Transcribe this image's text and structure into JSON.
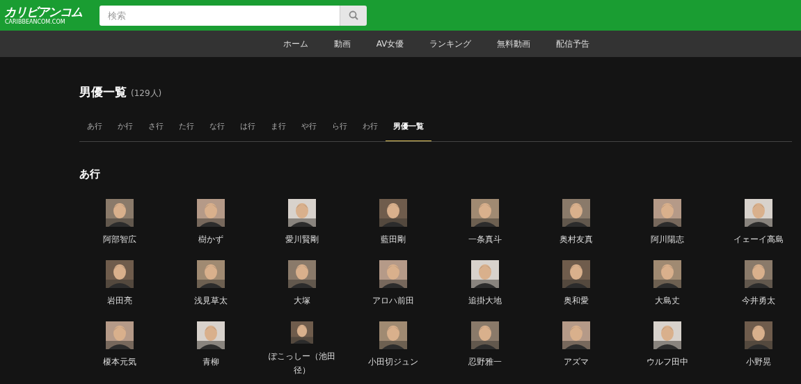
{
  "logo": {
    "title": "カリビアンコム",
    "subtitle": "CARIBBEANCOM.COM"
  },
  "search": {
    "placeholder": "検索"
  },
  "nav": [
    "ホーム",
    "動画",
    "AV女優",
    "ランキング",
    "無料動画",
    "配信予告"
  ],
  "page": {
    "title": "男優一覧",
    "count": "(129人)"
  },
  "tabs": [
    {
      "label": "あ行",
      "selected": false
    },
    {
      "label": "か行",
      "selected": false
    },
    {
      "label": "さ行",
      "selected": false
    },
    {
      "label": "た行",
      "selected": false
    },
    {
      "label": "な行",
      "selected": false
    },
    {
      "label": "は行",
      "selected": false
    },
    {
      "label": "ま行",
      "selected": false
    },
    {
      "label": "や行",
      "selected": false
    },
    {
      "label": "ら行",
      "selected": false
    },
    {
      "label": "わ行",
      "selected": false
    },
    {
      "label": "男優一覧",
      "selected": true
    }
  ],
  "section": {
    "heading": "あ行",
    "actors": [
      {
        "name": "阿部智広"
      },
      {
        "name": "樹かず"
      },
      {
        "name": "愛川賢剛"
      },
      {
        "name": "藍田剛"
      },
      {
        "name": "一条真斗"
      },
      {
        "name": "奥村友真"
      },
      {
        "name": "阿川陽志"
      },
      {
        "name": "イェーイ高島"
      },
      {
        "name": "岩田亮"
      },
      {
        "name": "浅見草太"
      },
      {
        "name": "大塚"
      },
      {
        "name": "アロハ前田"
      },
      {
        "name": "追掛大地"
      },
      {
        "name": "奥和愛"
      },
      {
        "name": "大島丈"
      },
      {
        "name": "今井勇太"
      },
      {
        "name": "榎本元気"
      },
      {
        "name": "青柳"
      },
      {
        "name": "ぽこっしー（池田径）"
      },
      {
        "name": "小田切ジュン"
      },
      {
        "name": "忍野雅一"
      },
      {
        "name": "アズマ"
      },
      {
        "name": "ウルフ田中"
      },
      {
        "name": "小野晃"
      }
    ]
  }
}
